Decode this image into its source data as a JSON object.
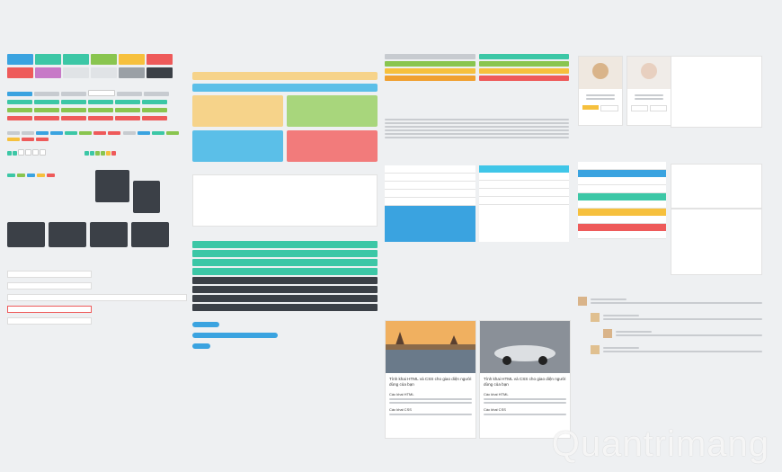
{
  "watermark": {
    "text": "Quantrimang"
  },
  "colors": {
    "teal": "#3cc7a6",
    "green": "#89c54f",
    "blue": "#3aa3e0",
    "cyan": "#3fc6e8",
    "yellow": "#f6c03d",
    "red": "#ee5a5a",
    "orange": "#f0a030",
    "dark": "#3b4047",
    "gray": "#c7cbd0"
  },
  "blog": {
    "posts": [
      {
        "title": "Tính khai HTML và CSS cho giao diện người dùng của bạn",
        "sub1": "Các khai HTML",
        "sub2": "Các khai CSS"
      },
      {
        "title": "Tính khai HTML và CSS cho giao diện người dùng của bạn",
        "sub1": "Các khai HTML",
        "sub2": "Các khai CSS"
      }
    ]
  }
}
